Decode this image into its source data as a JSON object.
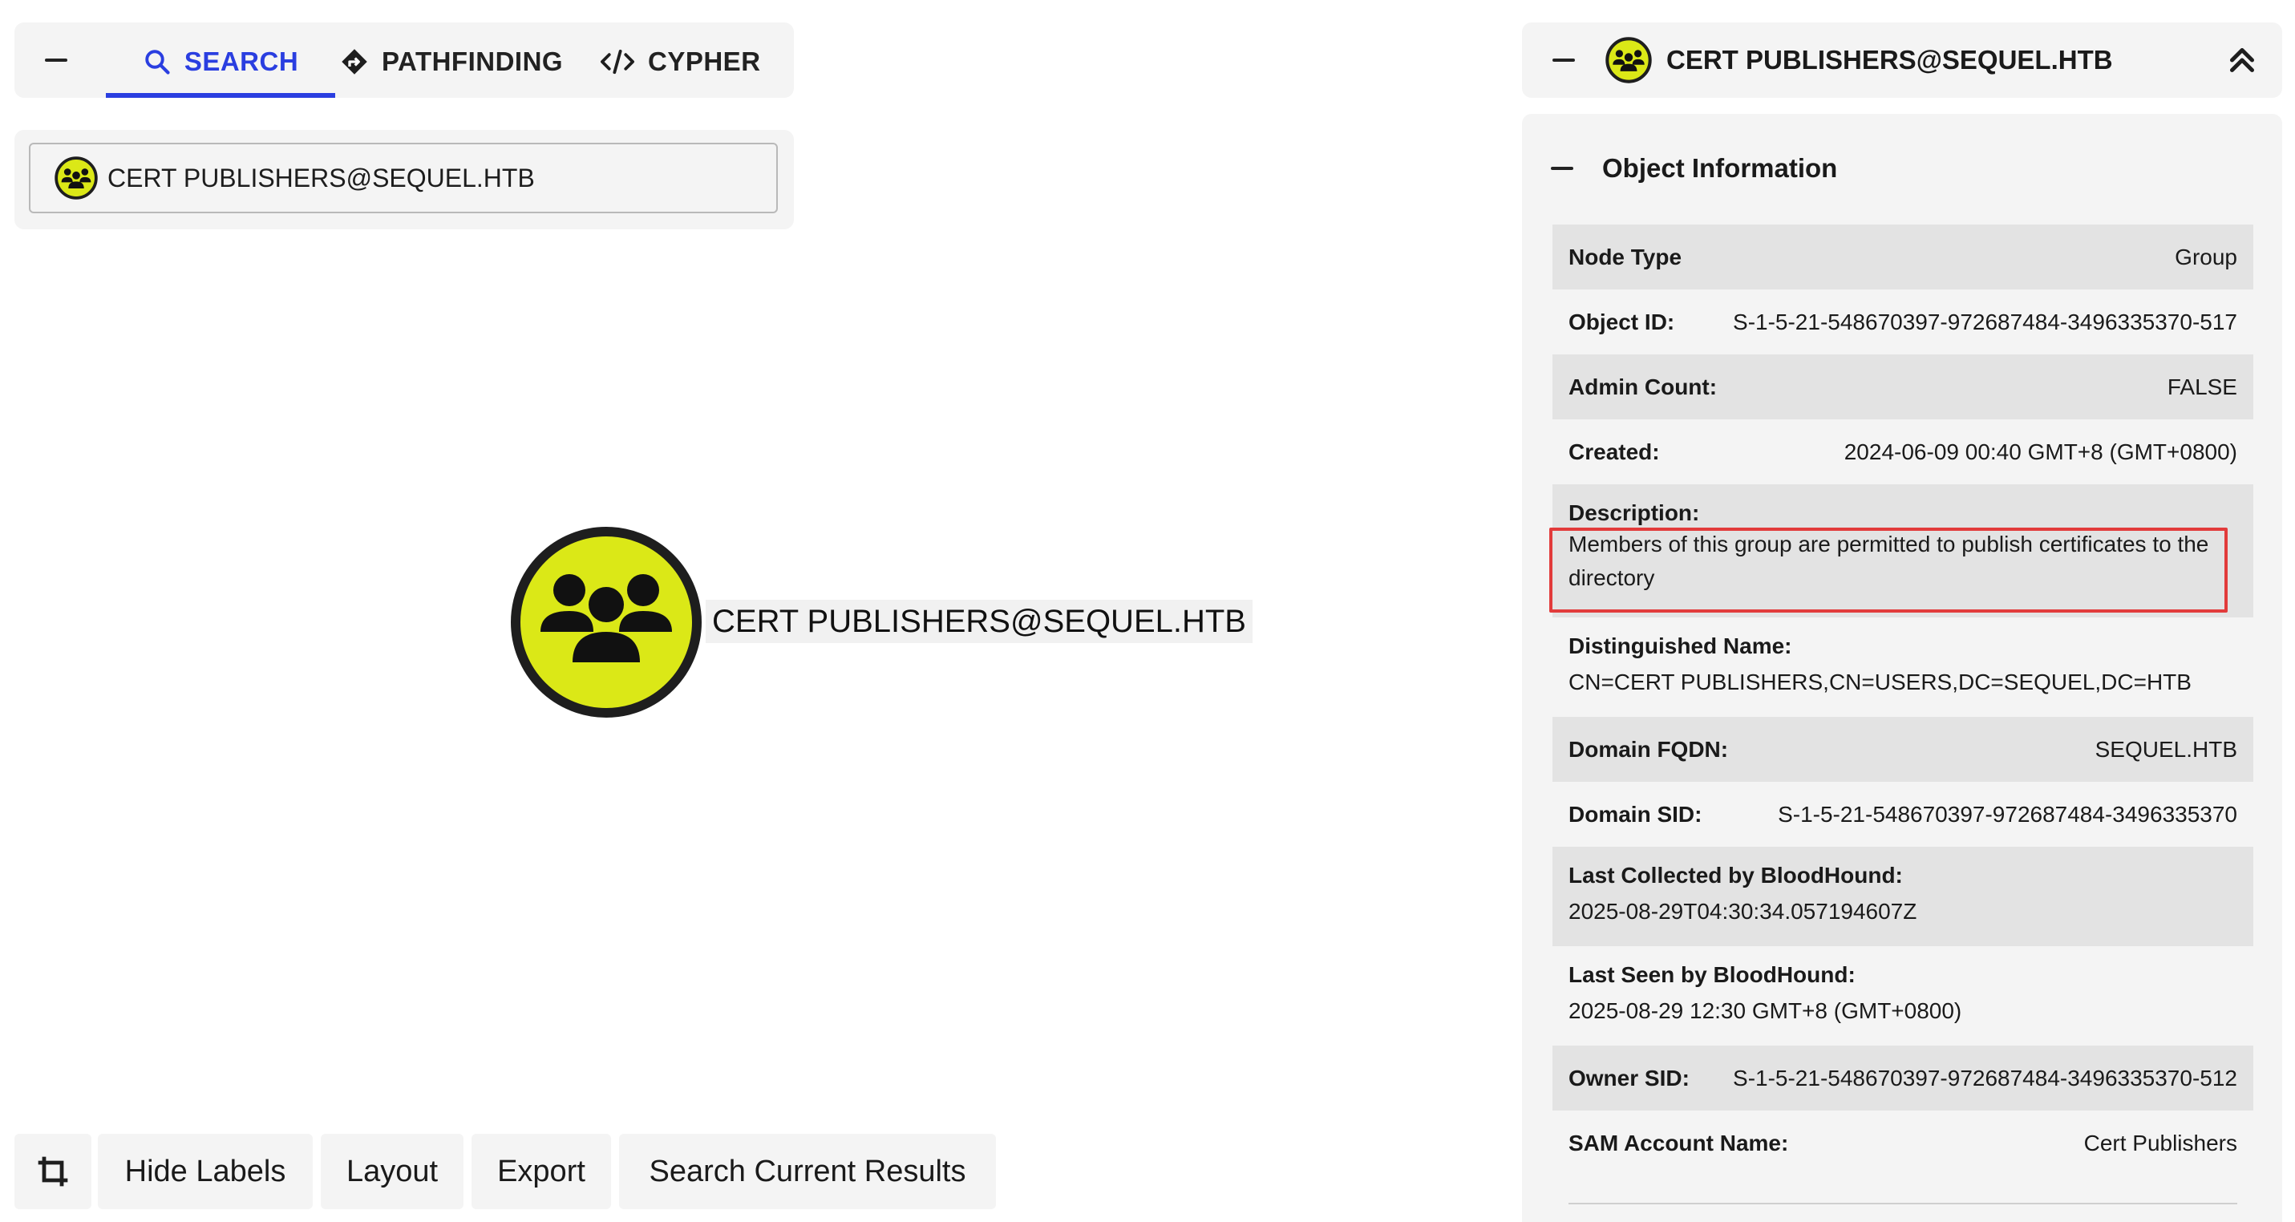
{
  "nav": {
    "tabs": [
      {
        "label": "SEARCH",
        "icon": "search-icon",
        "active": true
      },
      {
        "label": "PATHFINDING",
        "icon": "diamond-directions-icon",
        "active": false
      },
      {
        "label": "CYPHER",
        "icon": "code-icon",
        "active": false
      }
    ],
    "accent_color": "#2a3ee0"
  },
  "search": {
    "value": "CERT PUBLISHERS@SEQUEL.HTB",
    "icon": "group-icon"
  },
  "graph": {
    "node": {
      "label": "CERT PUBLISHERS@SEQUEL.HTB",
      "icon": "group-icon",
      "fill_color": "#dbe817",
      "border_color": "#1e1e1e"
    }
  },
  "toolbar": {
    "crop_icon": "crop-icon",
    "hide_labels": "Hide Labels",
    "layout": "Layout",
    "export": "Export",
    "search_current": "Search Current Results"
  },
  "panel": {
    "title": "CERT PUBLISHERS@SEQUEL.HTB",
    "section_title": "Object Information",
    "highlight_color": "#e23b3b",
    "properties": {
      "node_type": {
        "key": "Node Type",
        "value": "Group"
      },
      "object_id": {
        "key": "Object ID:",
        "value": "S-1-5-21-548670397-972687484-3496335370-517"
      },
      "admin_count": {
        "key": "Admin Count:",
        "value": "FALSE"
      },
      "created": {
        "key": "Created:",
        "value": "2024-06-09 00:40 GMT+8 (GMT+0800)"
      },
      "description": {
        "key": "Description:",
        "value": "Members of this group are permitted to publish certificates to the directory"
      },
      "distinguished_name": {
        "key": "Distinguished Name:",
        "value": "CN=CERT PUBLISHERS,CN=USERS,DC=SEQUEL,DC=HTB"
      },
      "domain_fqdn": {
        "key": "Domain FQDN:",
        "value": "SEQUEL.HTB"
      },
      "domain_sid": {
        "key": "Domain SID:",
        "value": "S-1-5-21-548670397-972687484-3496335370"
      },
      "last_collected": {
        "key": "Last Collected by BloodHound:",
        "value": "2025-08-29T04:30:34.057194607Z"
      },
      "last_seen": {
        "key": "Last Seen by BloodHound:",
        "value": "2025-08-29 12:30 GMT+8 (GMT+0800)"
      },
      "owner_sid": {
        "key": "Owner SID:",
        "value": "S-1-5-21-548670397-972687484-3496335370-512"
      },
      "sam_account_name": {
        "key": "SAM Account Name:",
        "value": "Cert Publishers"
      }
    }
  }
}
